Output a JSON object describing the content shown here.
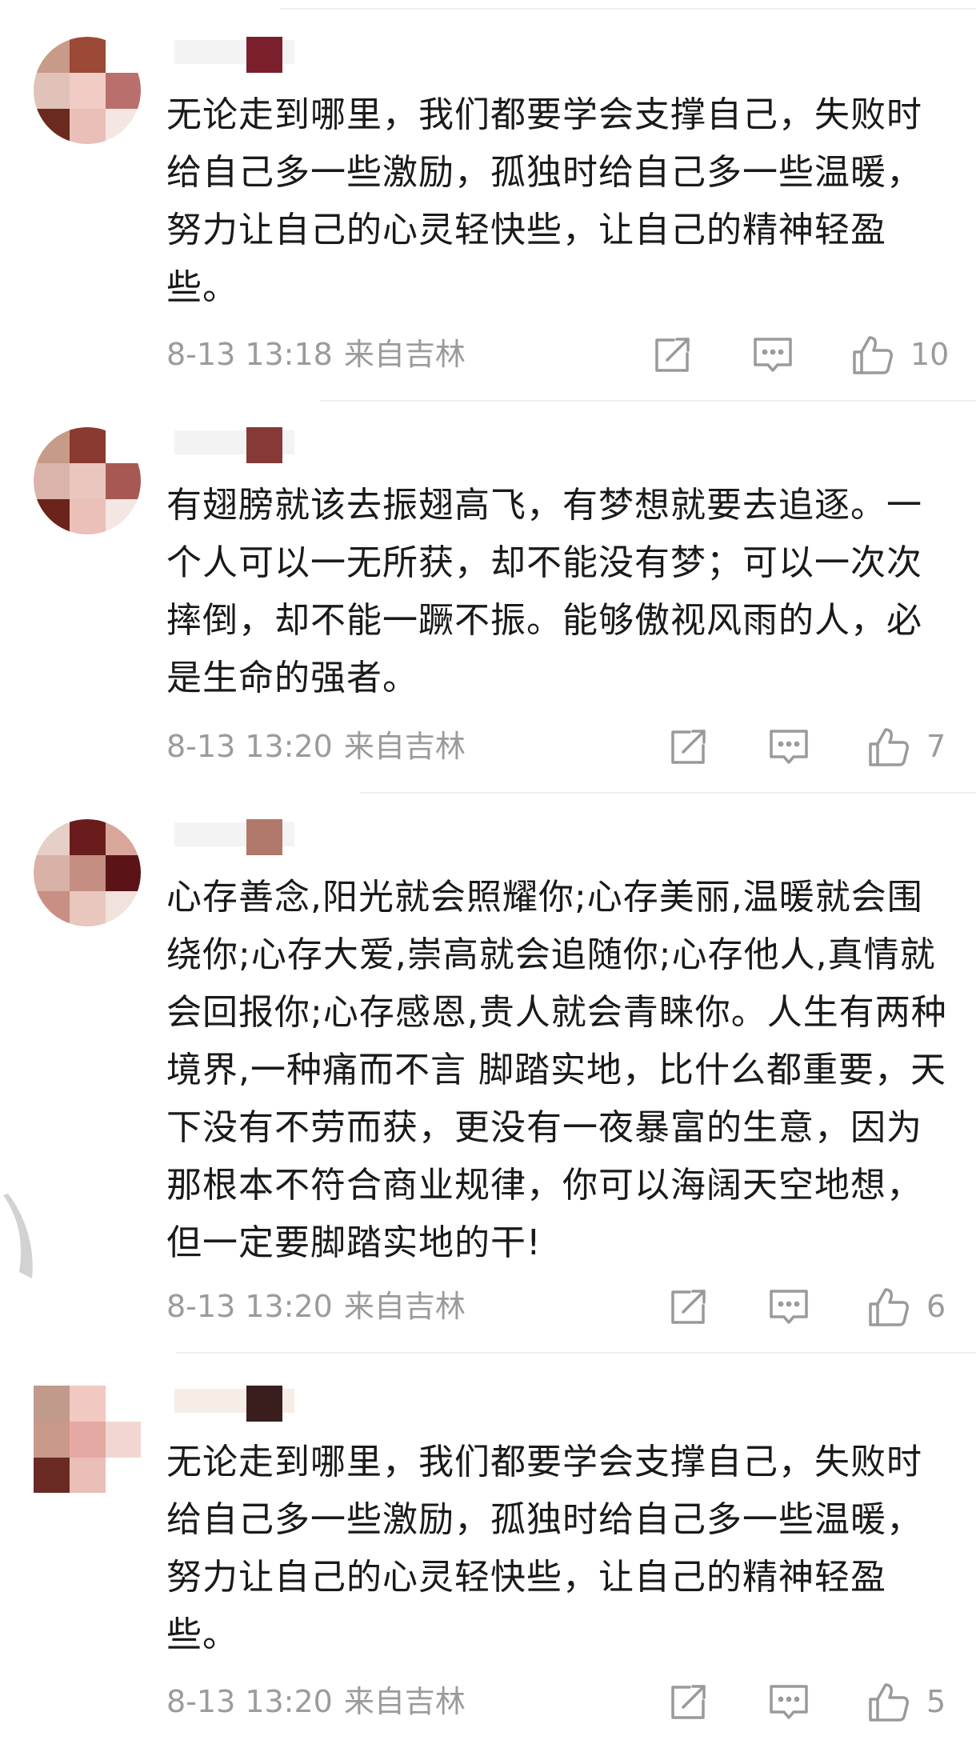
{
  "comments": [
    {
      "text": "无论走到哪里，我们都要学会支撑自己，失败时给自己多一些激励，孤独时给自己多一些温暖，努力让自己的心灵轻快些，让自己的精神轻盈些。",
      "time": "8-13 13:18",
      "location": "来自吉林",
      "likes": "10"
    },
    {
      "text": "有翅膀就该去振翅高飞，有梦想就要去追逐。一个人可以一无所获，却不能没有梦；可以一次次摔倒，却不能一蹶不振。能够傲视风雨的人，必是生命的强者。",
      "time": "8-13 13:20",
      "location": "来自吉林",
      "likes": "7"
    },
    {
      "text": "心存善念,阳光就会照耀你;心存美丽,温暖就会围绕你;心存大爱,崇高就会追随你;心存他人,真情就会回报你;心存感恩,贵人就会青睐你。人生有两种境界,一种痛而不言 脚踏实地，比什么都重要，天下没有不劳而获，更没有一夜暴富的生意，因为那根本不符合商业规律，你可以海阔天空地想，但一定要脚踏实地的干!",
      "time": "8-13 13:20",
      "location": "来自吉林",
      "likes": "6"
    },
    {
      "text": "无论走到哪里，我们都要学会支撑自己，失败时给自己多一些激励，孤独时给自己多一些温暖，努力让自己的心灵轻快些，让自己的精神轻盈些。",
      "time": "8-13 13:20",
      "location": "来自吉林",
      "likes": "5"
    }
  ],
  "icons": {
    "share": "share-icon",
    "reply": "comment-icon",
    "like": "thumbs-up-icon"
  },
  "colors": {
    "text": "#1a1a1a",
    "meta": "#9b9b9b",
    "icon": "#9a9a9a",
    "divider": "#efefef"
  }
}
